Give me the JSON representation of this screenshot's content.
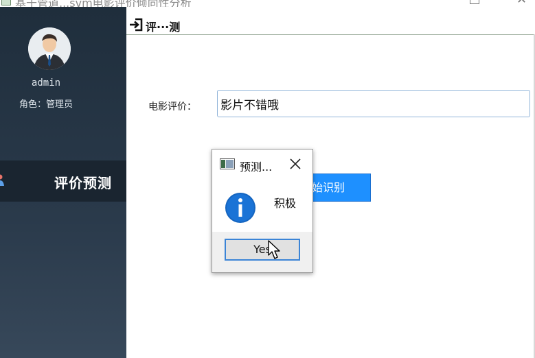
{
  "window": {
    "title": "基于管道...svm电影评价倾向性分析"
  },
  "sidebar": {
    "username": "admin",
    "role": "角色：管理员",
    "nav_items": [
      {
        "label": "评价预测",
        "icon": "user-icon"
      }
    ]
  },
  "main": {
    "header_title": "评···测",
    "review_label": "电影评价：",
    "review_value": "影片不错哦",
    "start_button_label": "始识别"
  },
  "dialog": {
    "title": "预测...",
    "message": "积极",
    "yes_button_label": "Yes",
    "icon": "info-icon"
  },
  "colors": {
    "sidebar_bg": "#1f2e3c",
    "nav_active_bg": "#1a2530",
    "accent_blue": "#1e90ff",
    "info_blue": "#1565c0"
  }
}
